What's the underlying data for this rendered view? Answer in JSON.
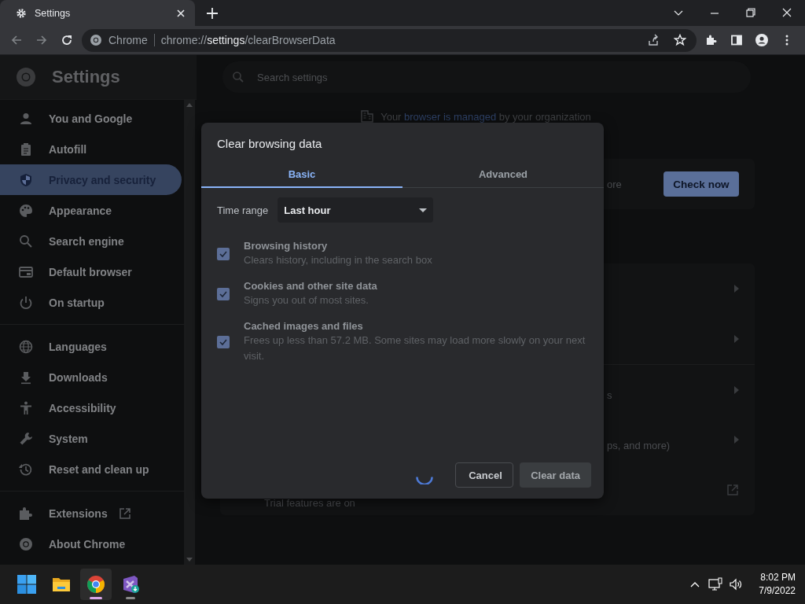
{
  "browser": {
    "tab": {
      "title": "Settings"
    },
    "address": {
      "origin": "Chrome",
      "url_scheme": "chrome://",
      "url_host": "settings",
      "url_path": "/clearBrowserData"
    }
  },
  "settings_page": {
    "title": "Settings",
    "search": {
      "placeholder": "Search settings"
    },
    "sidebar": {
      "groups": [
        [
          {
            "label": "You and Google",
            "selected": false
          },
          {
            "label": "Autofill",
            "selected": false
          },
          {
            "label": "Privacy and security",
            "selected": true
          },
          {
            "label": "Appearance",
            "selected": false
          },
          {
            "label": "Search engine",
            "selected": false
          },
          {
            "label": "Default browser",
            "selected": false
          },
          {
            "label": "On startup",
            "selected": false
          }
        ],
        [
          {
            "label": "Languages",
            "selected": false
          },
          {
            "label": "Downloads",
            "selected": false
          },
          {
            "label": "Accessibility",
            "selected": false
          },
          {
            "label": "System",
            "selected": false
          },
          {
            "label": "Reset and clean up",
            "selected": false
          }
        ],
        [
          {
            "label": "Extensions",
            "selected": false,
            "external": true
          },
          {
            "label": "About Chrome",
            "selected": false,
            "external": false
          }
        ]
      ]
    },
    "managed_notice": {
      "before": "Your ",
      "link": "browser is managed",
      "after": " by your organization"
    },
    "safety_card": {
      "text": "ore",
      "button": "Check now"
    },
    "rows": [
      {
        "kind": "arrow"
      },
      {
        "kind": "arrow"
      },
      {
        "kind": "arrow",
        "text": "s"
      },
      {
        "kind": "arrow",
        "text": "ps, and more)"
      },
      {
        "kind": "external",
        "text": "Trial features are on"
      }
    ]
  },
  "dialog": {
    "title": "Clear browsing data",
    "tabs": [
      {
        "label": "Basic",
        "selected": true
      },
      {
        "label": "Advanced",
        "selected": false
      }
    ],
    "time_range": {
      "label": "Time range",
      "value": "Last hour"
    },
    "options": [
      {
        "title": "Browsing history",
        "description": "Clears history, including in the search box",
        "checked": true,
        "disabled": true
      },
      {
        "title": "Cookies and other site data",
        "description": "Signs you out of most sites.",
        "checked": true,
        "disabled": true
      },
      {
        "title": "Cached images and files",
        "description": "Frees up less than 57.2 MB. Some sites may load more slowly on your next visit.",
        "checked": true,
        "disabled": true
      }
    ],
    "loading": true,
    "buttons": [
      {
        "kind": "cancel",
        "label": "Cancel"
      },
      {
        "kind": "confirm",
        "label": "Clear data",
        "disabled": true
      }
    ]
  },
  "taskbar": {
    "apps": [
      {
        "kind": "start",
        "running": false,
        "active": false
      },
      {
        "kind": "folder",
        "running": false,
        "active": false
      },
      {
        "kind": "browser",
        "running": true,
        "active": true
      },
      {
        "kind": "ide",
        "running": true,
        "active": false
      }
    ],
    "clock": {
      "time": "8:02 PM",
      "date": "7/9/2022"
    }
  }
}
